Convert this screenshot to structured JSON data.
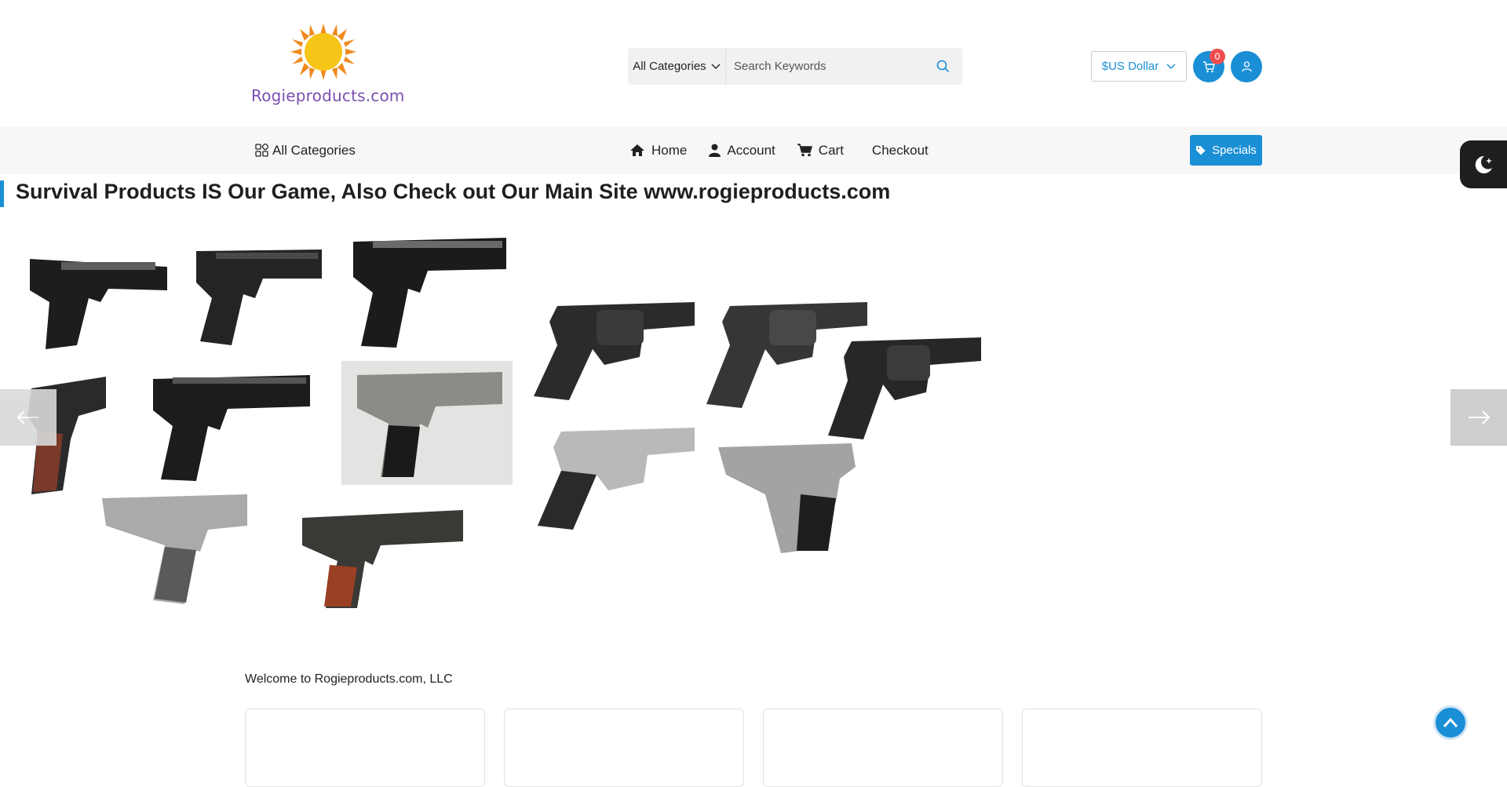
{
  "brand": {
    "logo_text": "Rogieproducts.com"
  },
  "search": {
    "category_label": "All Categories",
    "placeholder": "Search Keywords"
  },
  "header": {
    "currency_label": "$US Dollar",
    "cart_count": "0"
  },
  "nav": {
    "all_categories": "All Categories",
    "links": [
      {
        "label": "Home",
        "icon": "home-icon"
      },
      {
        "label": "Account",
        "icon": "user-icon"
      },
      {
        "label": "Cart",
        "icon": "cart-icon"
      },
      {
        "label": "Checkout"
      }
    ],
    "specials_label": "Specials"
  },
  "page": {
    "title": "Survival Products IS Our Game, Also Check out Our Main Site www.rogieproducts.com",
    "welcome": "Welcome to Rogieproducts.com, LLC"
  },
  "colors": {
    "accent": "#1a8fd6",
    "badge": "#ef4d4d",
    "nav_bg": "#f7f7f8",
    "toggle_bg": "#1e1e1e"
  }
}
